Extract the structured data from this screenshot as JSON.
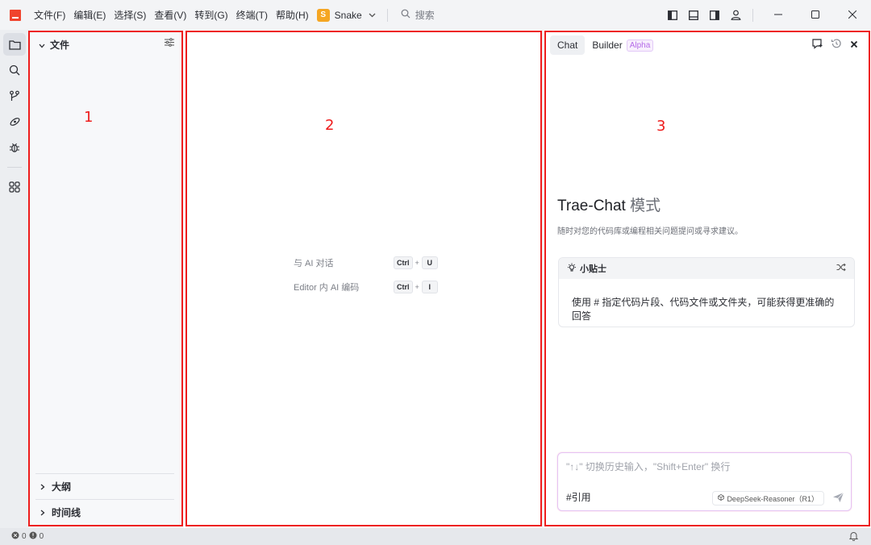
{
  "titlebar": {
    "menus": [
      "文件(F)",
      "编辑(E)",
      "选择(S)",
      "查看(V)",
      "转到(G)",
      "终端(T)",
      "帮助(H)"
    ],
    "project_badge": "S",
    "project_name": "Snake",
    "search_label": "搜索",
    "icons": [
      "toggle-left-panel-icon",
      "toggle-bottom-panel-icon",
      "toggle-right-panel-icon",
      "account-icon"
    ],
    "window_controls": [
      "minimize-icon",
      "maximize-icon",
      "close-icon"
    ]
  },
  "activitybar": {
    "items": [
      "explorer-icon",
      "search-icon",
      "source-control-icon",
      "remote-icon",
      "debug-icon",
      "extensions-icon"
    ],
    "active": "explorer-icon"
  },
  "sidebar": {
    "title": "文件",
    "outline_label": "大纲",
    "timeline_label": "时间线"
  },
  "editor": {
    "hints": [
      {
        "label": "与 AI 对话",
        "keys": [
          "Ctrl",
          "U"
        ]
      },
      {
        "label": "Editor 内 AI 编码",
        "keys": [
          "Ctrl",
          "I"
        ]
      }
    ]
  },
  "chat": {
    "tab_chat": "Chat",
    "tab_builder": "Builder",
    "builder_badge": "Alpha",
    "title_main": "Trae-Chat",
    "title_mode": "模式",
    "subtitle": "随时对您的代码库或编程相关问题提问或寻求建议。",
    "tip_title": "小贴士",
    "tip_body": "使用 # 指定代码片段、代码文件或文件夹，可能获得更准确的回答",
    "input_placeholder": "\"↑↓\" 切换历史输入，\"Shift+Enter\" 换行",
    "reference_label": "#引用",
    "model_name": "DeepSeek-Reasoner（R1）"
  },
  "statusbar": {
    "errors": "0",
    "warnings": "0"
  },
  "annotations": [
    "1",
    "2",
    "3"
  ],
  "colors": {
    "annotation": "#ee1c1c",
    "project_badge": "#f5a623",
    "app_logo": "#f0442d",
    "alpha_badge": "#b56be8"
  }
}
